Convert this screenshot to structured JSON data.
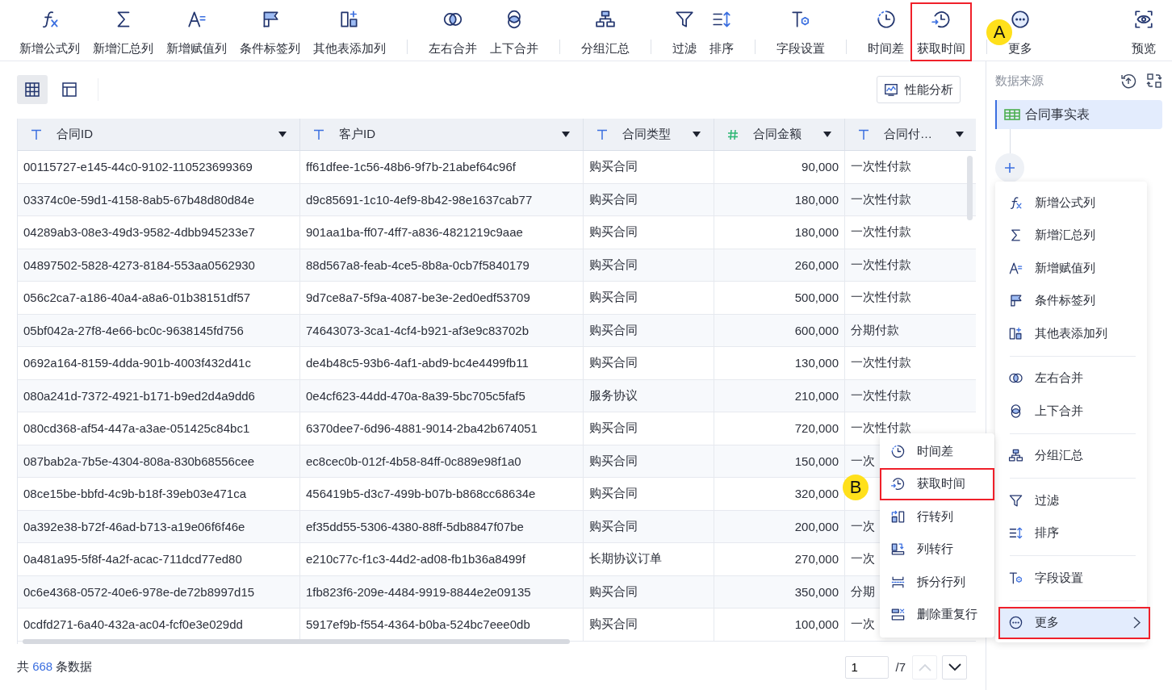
{
  "toolbar": {
    "groups": [
      [
        {
          "label": "新增公式列",
          "highlighted": false
        },
        {
          "label": "新增汇总列",
          "highlighted": false
        },
        {
          "label": "新增赋值列",
          "highlighted": false
        },
        {
          "label": "条件标签列",
          "highlighted": false
        },
        {
          "label": "其他表添加列",
          "highlighted": false
        }
      ],
      [
        {
          "label": "左右合并",
          "highlighted": false
        },
        {
          "label": "上下合并",
          "highlighted": false
        }
      ],
      [
        {
          "label": "分组汇总",
          "highlighted": false
        }
      ],
      [
        {
          "label": "过滤",
          "highlighted": false
        },
        {
          "label": "排序",
          "highlighted": false
        }
      ],
      [
        {
          "label": "字段设置",
          "highlighted": false
        }
      ],
      [
        {
          "label": "时间差",
          "highlighted": false
        },
        {
          "label": "获取时间",
          "highlighted": true
        }
      ],
      [
        {
          "label": "更多",
          "highlighted": false
        }
      ]
    ],
    "preview": {
      "label": "预览"
    }
  },
  "annotations": [
    {
      "label": "A"
    },
    {
      "label": "B"
    }
  ],
  "view_switch": [
    {
      "selected": true
    },
    {
      "selected": false
    }
  ],
  "performance_button": "性能分析",
  "table": {
    "columns": [
      {
        "name": "合同ID",
        "kind": "text"
      },
      {
        "name": "客户ID",
        "kind": "text"
      },
      {
        "name": "合同类型",
        "kind": "text"
      },
      {
        "name": "合同金额",
        "kind": "number"
      },
      {
        "name": "合同付…",
        "kind": "text"
      }
    ],
    "rows": [
      [
        "00115727-e145-44c0-9102-110523699369",
        "ff61dfee-1c56-48b6-9f7b-21abef64c96f",
        "购买合同",
        "90,000",
        "一次性付款"
      ],
      [
        "03374c0e-59d1-4158-8ab5-67b48d80d84e",
        "d9c85691-1c10-4ef9-8b42-98e1637cab77",
        "购买合同",
        "180,000",
        "一次性付款"
      ],
      [
        "04289ab3-08e3-49d3-9582-4dbb945233e7",
        "901aa1ba-ff07-4ff7-a836-4821219c9aae",
        "购买合同",
        "180,000",
        "一次性付款"
      ],
      [
        "04897502-5828-4273-8184-553aa0562930",
        "88d567a8-feab-4ce5-8b8a-0cb7f5840179",
        "购买合同",
        "260,000",
        "一次性付款"
      ],
      [
        "056c2ca7-a186-40a4-a8a6-01b38151df57",
        "9d7ce8a7-5f9a-4087-be3e-2ed0edf53709",
        "购买合同",
        "500,000",
        "一次性付款"
      ],
      [
        "05bf042a-27f8-4e66-bc0c-9638145fd756",
        "74643073-3ca1-4cf4-b921-af3e9c83702b",
        "购买合同",
        "600,000",
        "分期付款"
      ],
      [
        "0692a164-8159-4dda-901b-4003f432d41c",
        "de4b48c5-93b6-4af1-abd9-bc4e4499fb11",
        "购买合同",
        "130,000",
        "一次性付款"
      ],
      [
        "080a241d-7372-4921-b171-b9ed2d4a9dd6",
        "0e4cf623-44dd-470a-8a39-5bc705c5faf5",
        "服务协议",
        "210,000",
        "一次性付款"
      ],
      [
        "080cd368-af54-447a-a3ae-051425c84bc1",
        "6370dee7-6d96-4881-9014-2ba42b674051",
        "购买合同",
        "720,000",
        "一次性付款"
      ],
      [
        "087bab2a-7b5e-4304-808a-830b68556cee",
        "ec8cec0b-012f-4b58-84ff-0c889e98f1a0",
        "购买合同",
        "150,000",
        "一次"
      ],
      [
        "08ce15be-bbfd-4c9b-b18f-39eb03e471ca",
        "456419b5-d3c7-499b-b07b-b868cc68634e",
        "购买合同",
        "320,000"
      ],
      [
        "0a392e38-b72f-46ad-b713-a19e06f6f46e",
        "ef35dd55-5306-4380-88ff-5db8847f07be",
        "购买合同",
        "200,000",
        "一次"
      ],
      [
        "0a481a95-5f8f-4a2f-acac-711dcd77ed80",
        "e210c77c-f1c3-44d2-ad08-fb1b36a8499f",
        "长期协议订单",
        "270,000",
        "一次"
      ],
      [
        "0c6e4368-0572-40e6-978e-de72b8997d15",
        "1fb823f6-209e-4484-9919-8844e2e09135",
        "购买合同",
        "350,000",
        "分期"
      ],
      [
        "0cdfd271-6a40-432a-ac04-fcf0e3e029dd",
        "5917ef9b-f554-4364-b0ba-524bc7eee0db",
        "购买合同",
        "100,000",
        "一次"
      ]
    ]
  },
  "footer": {
    "count_prefix": "共",
    "count": "668",
    "count_suffix": "条数据"
  },
  "pagination": {
    "page": "1",
    "total": "/7",
    "prev_disabled": true,
    "next_disabled": false
  },
  "side_panel": {
    "title": "数据来源",
    "source": {
      "name": "合同事实表",
      "selected": true
    },
    "menu": [
      [
        {
          "label": "新增公式列",
          "selected": false,
          "highlighted": false
        },
        {
          "label": "新增汇总列",
          "selected": false,
          "highlighted": false
        },
        {
          "label": "新增赋值列",
          "selected": false,
          "highlighted": false
        },
        {
          "label": "条件标签列",
          "selected": false,
          "highlighted": false
        },
        {
          "label": "其他表添加列",
          "selected": false,
          "highlighted": false
        }
      ],
      [
        {
          "label": "左右合并",
          "selected": false,
          "highlighted": false
        },
        {
          "label": "上下合并",
          "selected": false,
          "highlighted": false
        }
      ],
      [
        {
          "label": "分组汇总",
          "selected": false,
          "highlighted": false
        }
      ],
      [
        {
          "label": "过滤",
          "selected": false,
          "highlighted": false
        },
        {
          "label": "排序",
          "selected": false,
          "highlighted": false
        }
      ],
      [
        {
          "label": "字段设置",
          "selected": false,
          "highlighted": false
        }
      ],
      [
        {
          "label": "更多",
          "selected": true,
          "highlighted": true
        }
      ]
    ],
    "submenu": [
      {
        "label": "时间差",
        "highlighted": false
      },
      {
        "label": "获取时间",
        "highlighted": true
      },
      {
        "label": "行转列",
        "highlighted": false
      },
      {
        "label": "列转行",
        "highlighted": false
      },
      {
        "label": "拆分行列",
        "highlighted": false
      },
      {
        "label": "删除重复行",
        "highlighted": false
      }
    ]
  }
}
